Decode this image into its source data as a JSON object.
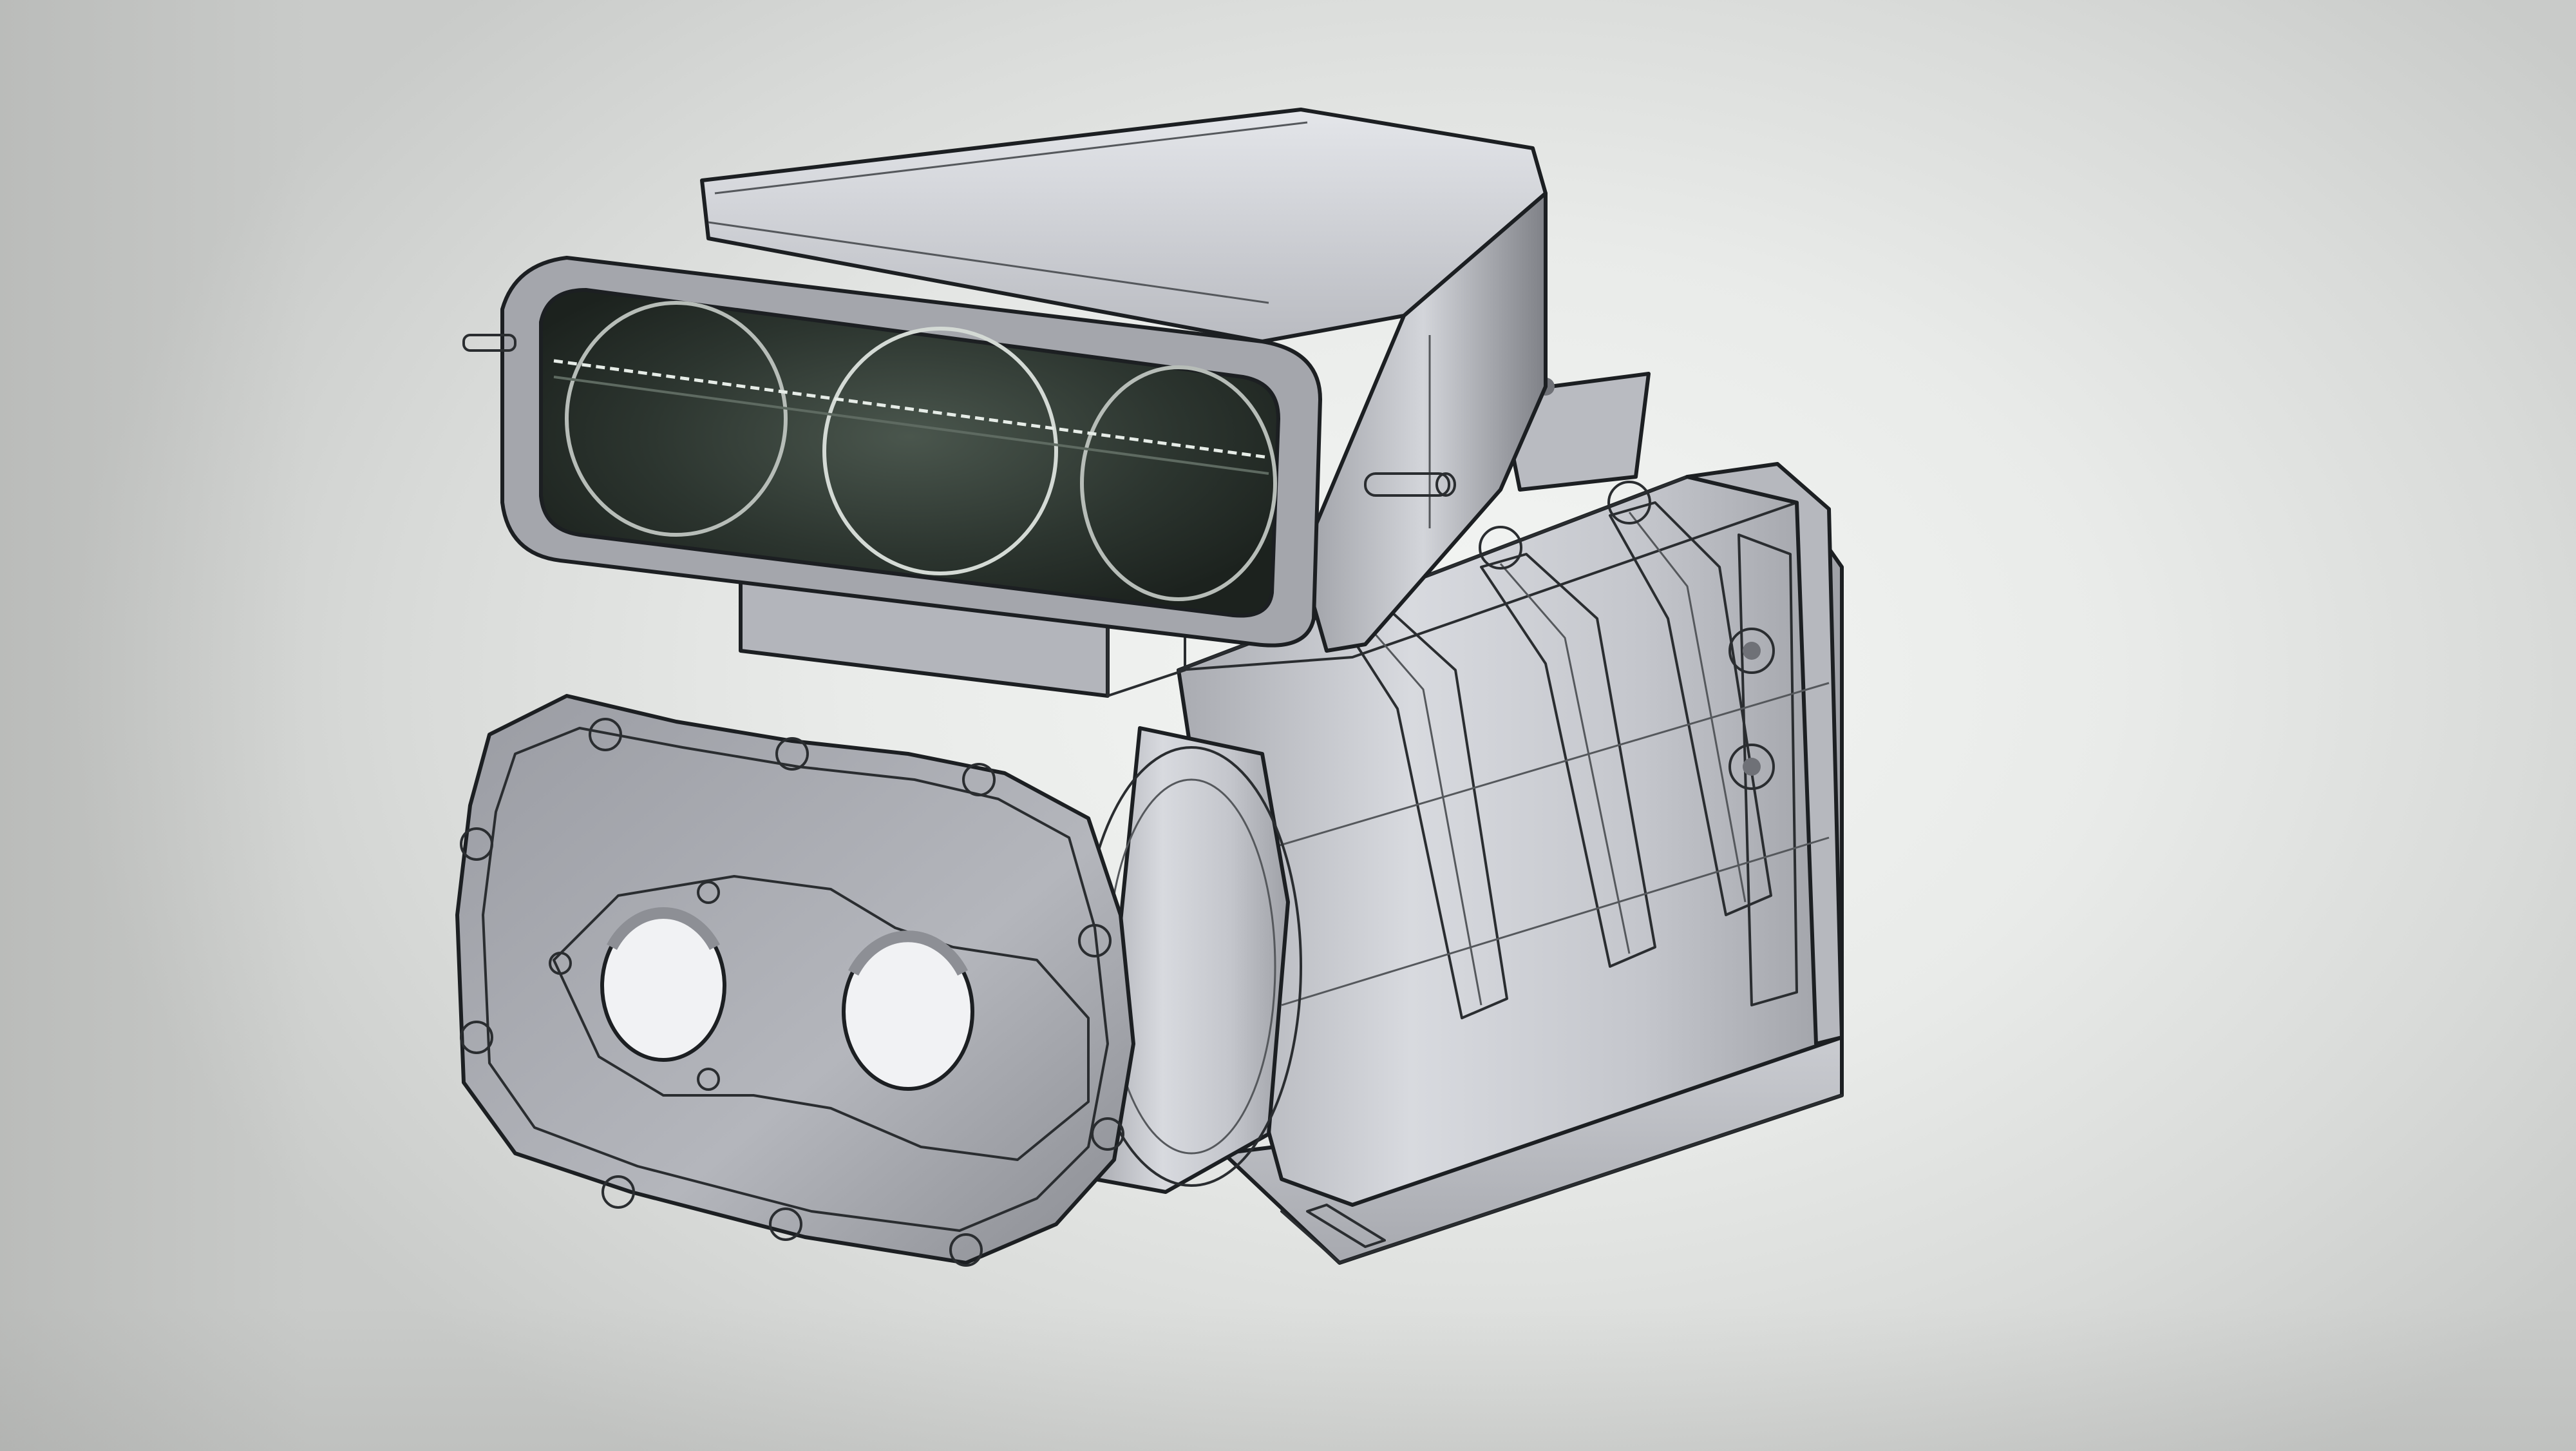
{
  "viewport": {
    "background_center": "#f4f6f4",
    "background_edge": "#c9cbc9"
  },
  "model": {
    "body_color": "#c8c9cf",
    "body_shadow": "#8e9096",
    "body_highlight": "#eef0f4",
    "edge_color": "#1c1f22",
    "scoop_interior": "#2f3a33"
  }
}
